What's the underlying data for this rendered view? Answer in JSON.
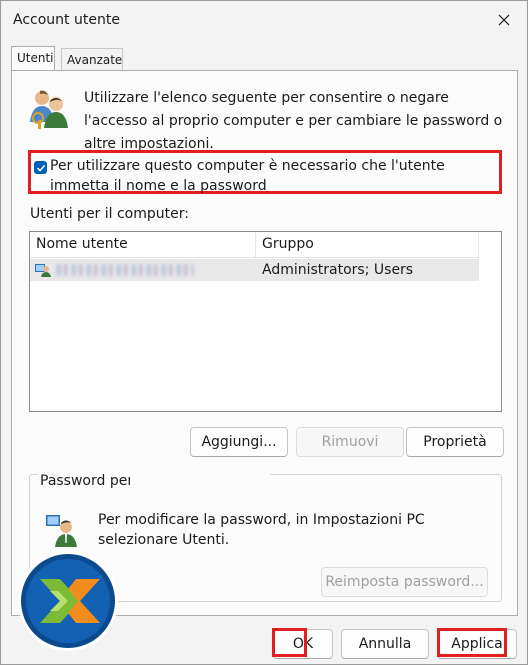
{
  "window": {
    "title": "Account utente"
  },
  "tabs": [
    {
      "label": "Utenti"
    },
    {
      "label": "Avanzate"
    }
  ],
  "intro": {
    "text": "Utilizzare l'elenco seguente per consentire o negare l'accesso al proprio computer e per cambiare le password o altre impostazioni."
  },
  "require_login": {
    "label": "Per utilizzare questo computer è necessario che l'utente immetta il nome e la password",
    "checked": true
  },
  "users": {
    "label": "Utenti per il computer:",
    "columns": [
      "Nome utente",
      "Gruppo"
    ],
    "rows": [
      {
        "group": "Administrators; Users"
      }
    ]
  },
  "user_buttons": {
    "add": "Aggiungi...",
    "remove": "Rimuovi",
    "properties": "Proprietà"
  },
  "password": {
    "legend": "Password per",
    "text": "Per modificare la password, in Impostazioni PC selezionare Utenti.",
    "reset": "Reimposta password..."
  },
  "dialog_buttons": {
    "ok": "OK",
    "cancel": "Annulla",
    "apply": "Applica"
  },
  "colors": {
    "highlight": "#e02020",
    "accent": "#005fb8"
  },
  "icons": [
    "close-icon",
    "users-icon",
    "checkmark-icon",
    "user-icon",
    "key-user-icon",
    "brand-logo-icon"
  ]
}
